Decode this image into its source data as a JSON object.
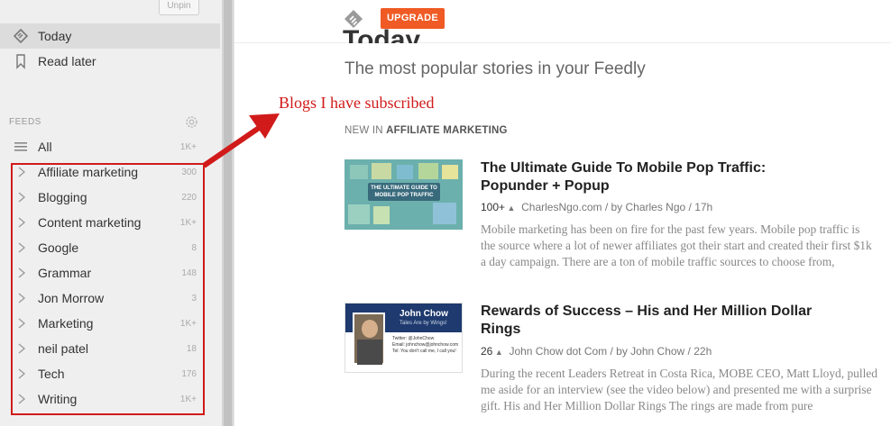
{
  "sidebar": {
    "unpin_label": "Unpin",
    "nav": [
      {
        "label": "Today",
        "icon": "feedly-today-icon",
        "active": true
      },
      {
        "label": "Read later",
        "icon": "bookmark-icon",
        "active": false
      }
    ],
    "feeds_header": "FEEDS",
    "all": {
      "label": "All",
      "count": "1K+"
    },
    "feeds": [
      {
        "label": "Affiliate marketing",
        "count": "300"
      },
      {
        "label": "Blogging",
        "count": "220"
      },
      {
        "label": "Content marketing",
        "count": "1K+"
      },
      {
        "label": "Google",
        "count": "8"
      },
      {
        "label": "Grammar",
        "count": "148"
      },
      {
        "label": "Jon Morrow",
        "count": "3"
      },
      {
        "label": "Marketing",
        "count": "1K+"
      },
      {
        "label": "neil patel",
        "count": "18"
      },
      {
        "label": "Tech",
        "count": "176"
      },
      {
        "label": "Writing",
        "count": "1K+"
      }
    ]
  },
  "header": {
    "upgrade_label": "UPGRADE",
    "title_peek": "Today",
    "subtitle": "The most popular stories in your Feedly"
  },
  "annotation": {
    "text": "Blogs I have subscribed",
    "color": "#d11a1a"
  },
  "section": {
    "prefix": "NEW IN ",
    "feed_name": "AFFILIATE MARKETING"
  },
  "stories": [
    {
      "title": "The Ultimate Guide To Mobile Pop Traffic: Popunder + Popup",
      "count": "100+",
      "meta": "CharlesNgo.com / by Charles Ngo / 17h",
      "thumb_caption": "THE ULTIMATE GUIDE TO MOBILE POP TRAFFIC",
      "body": "Mobile marketing has been on fire for the past few years. Mobile pop traffic is the source where a lot of newer affiliates got their start and created their first $1k a day campaign. There are a ton of mobile traffic sources to choose from,"
    },
    {
      "title": "Rewards of Success – His and Her Million Dollar Rings",
      "count": "26",
      "meta": "John Chow dot Com / by John Chow / 22h",
      "thumb_name": "John Chow",
      "thumb_tagline": "Tales Are by Wings!",
      "thumb_lines": [
        "Twitter: @JohnChow",
        "Email: johnchow@johnchow.com",
        "Tel: You don't call me, I call you!"
      ],
      "body": "During the recent Leaders Retreat in Costa Rica, MOBE CEO, Matt Lloyd, pulled me aside for an interview (see the video below) and presented me with a surprise gift. His and Her Million Dollar Rings The rings are made from pure"
    }
  ],
  "colors": {
    "accent": "#f05a24",
    "annotation": "#d11a1a",
    "sidebar_bg": "#efefef"
  }
}
